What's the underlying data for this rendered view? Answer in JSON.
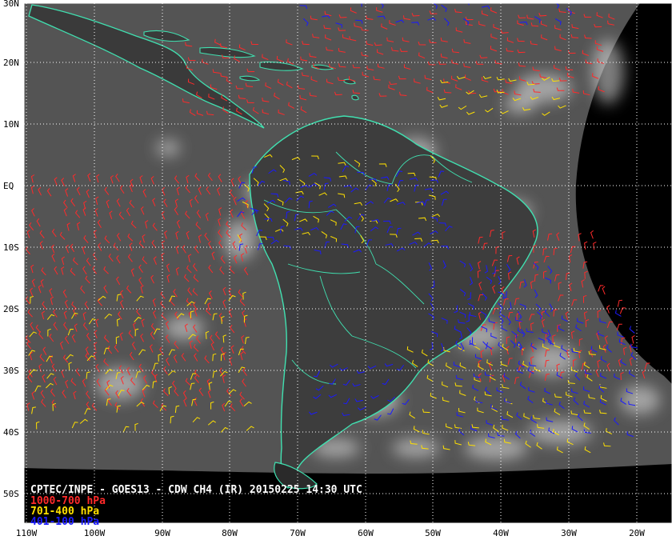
{
  "title": "CPTEC/INPE - GOES13 - CDW CH4 (IR) 20150225 14:30 UTC",
  "legend": [
    {
      "label": "1000-700 hPa",
      "color": "#ff2a2a"
    },
    {
      "label": "701-400 hPa",
      "color": "#ffe000"
    },
    {
      "label": "401-100 hPa",
      "color": "#1a1aff"
    }
  ],
  "axes": {
    "lat_labels": [
      "30N",
      "20N",
      "10N",
      "EQ",
      "10S",
      "20S",
      "30S",
      "40S",
      "50S"
    ],
    "lon_labels": [
      "110W",
      "100W",
      "90W",
      "80W",
      "70W",
      "60W",
      "50W",
      "40W",
      "30W",
      "20W"
    ]
  },
  "colors": {
    "coast": "#40e0b0",
    "grid": "#ffffff",
    "space": "#000000",
    "frame": "#ffffff",
    "sea_ir": "#545454",
    "land_ir": "#4a4a4a",
    "cloud_ir": "#e6e6e6"
  }
}
